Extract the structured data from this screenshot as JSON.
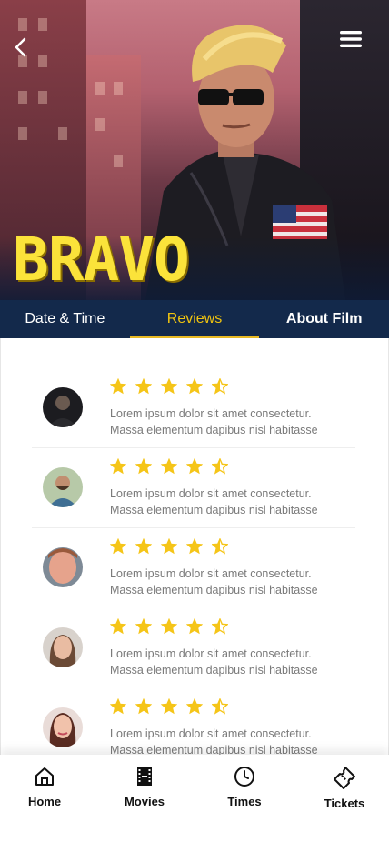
{
  "hero": {
    "title_art": "BRAVO",
    "back_icon": "chevron-left-icon",
    "menu_icon": "hamburger-menu-icon"
  },
  "tabs": [
    {
      "label": "Date & Time",
      "active": false
    },
    {
      "label": "Reviews",
      "active": true
    },
    {
      "label": "About Film",
      "active": false
    }
  ],
  "reviews": [
    {
      "rating": 4.5,
      "text_line1": "Lorem ipsum dolor sit amet consectetur.",
      "text_line2": "Massa elementum dapibus nisl habitasse"
    },
    {
      "rating": 4.5,
      "text_line1": "Lorem ipsum dolor sit amet consectetur.",
      "text_line2": "Massa elementum dapibus nisl habitasse"
    },
    {
      "rating": 4.5,
      "text_line1": "Lorem ipsum dolor sit amet consectetur.",
      "text_line2": "Massa elementum dapibus nisl habitasse"
    },
    {
      "rating": 4.5,
      "text_line1": "Lorem ipsum dolor sit amet consectetur.",
      "text_line2": "Massa elementum dapibus nisl habitasse"
    },
    {
      "rating": 4.5,
      "text_line1": "Lorem ipsum dolor sit amet consectetur.",
      "text_line2": "Massa elementum dapibus nisl habitasse"
    }
  ],
  "bottom_nav": [
    {
      "label": "Home",
      "icon": "home-icon"
    },
    {
      "label": "Movies",
      "icon": "film-icon"
    },
    {
      "label": "Times",
      "icon": "clock-icon"
    },
    {
      "label": "Tickets",
      "icon": "ticket-icon"
    }
  ],
  "colors": {
    "tab_bar": "#13294b",
    "accent": "#f1c40f",
    "star": "#f5c518",
    "title_art": "#fbe33a"
  }
}
